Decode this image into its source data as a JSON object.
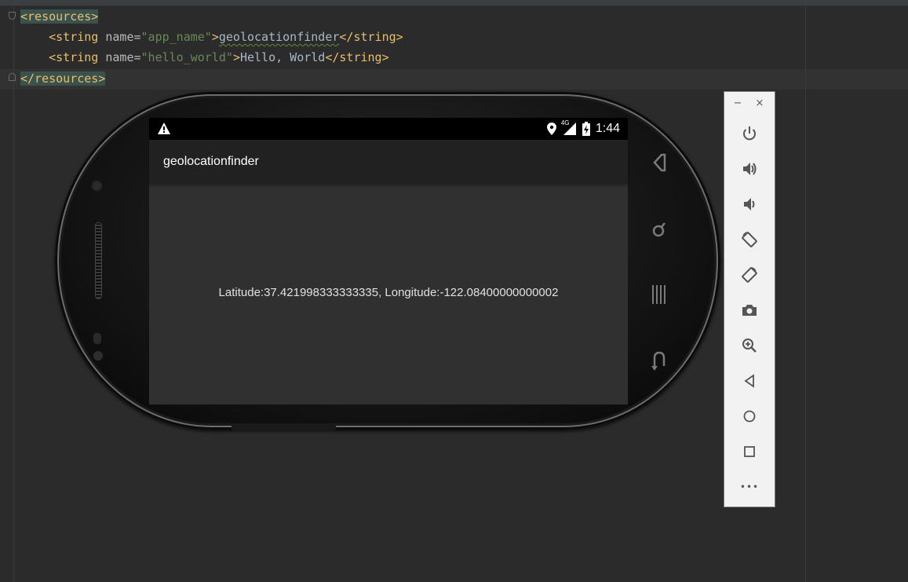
{
  "editor": {
    "lines": [
      {
        "open_tag": "<resources>"
      },
      {
        "indent": "    ",
        "tag_start": "<string ",
        "attr": "name=",
        "value": "\"app_name\"",
        "tag_close": ">",
        "text": "geolocationfinder",
        "end_tag": "</string>"
      },
      {
        "indent": "    ",
        "tag_start": "<string ",
        "attr": "name=",
        "value": "\"hello_world\"",
        "tag_close": ">",
        "text": "Hello, World",
        "end_tag": "</string>"
      },
      {
        "close_tag": "</resources>"
      }
    ]
  },
  "device": {
    "status_bar": {
      "time": "1:44",
      "network_label": "4G",
      "icons": [
        "warning-icon",
        "location-icon",
        "signal-icon",
        "battery-icon"
      ]
    },
    "app_title": "geolocationfinder",
    "location_text": "Latitude:37.421998333333335, Longitude:-122.08400000000002",
    "hardware_keys": [
      "home-key-icon",
      "search-key-icon",
      "menu-key-icon",
      "back-key-icon"
    ]
  },
  "emulator_toolbar": {
    "window_controls": [
      "−",
      "×"
    ],
    "tools": [
      "power-icon",
      "volume-up-icon",
      "volume-down-icon",
      "rotate-left-icon",
      "rotate-right-icon",
      "camera-icon",
      "zoom-icon",
      "back-icon",
      "home-icon",
      "overview-icon",
      "more-icon"
    ],
    "more_label": "•••"
  },
  "colors": {
    "editor_bg": "#2b2b2b",
    "tag": "#e8bf6a",
    "string_value": "#6a8759",
    "attribute": "#bababa",
    "toolbar_bg": "#f2f2f2"
  }
}
